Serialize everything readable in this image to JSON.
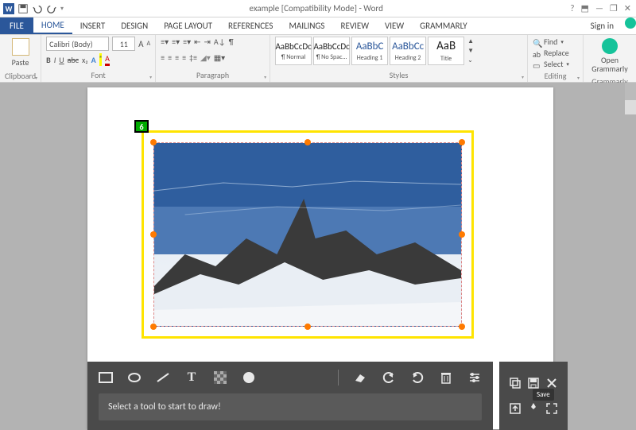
{
  "titlebar": {
    "title": "example [Compatibility Mode] - Word"
  },
  "window_controls": {
    "help": "?",
    "ribbon_toggle": "⬒",
    "minimize": "—",
    "restore": "❐",
    "close": "✕"
  },
  "ribbon_tabs": {
    "file": "FILE",
    "home": "HOME",
    "insert": "INSERT",
    "design": "DESIGN",
    "page_layout": "PAGE LAYOUT",
    "references": "REFERENCES",
    "mailings": "MAILINGS",
    "review": "REVIEW",
    "view": "VIEW",
    "grammarly": "GRAMMARLY",
    "signin": "Sign in"
  },
  "ribbon": {
    "clipboard": {
      "paste": "Paste",
      "label": "Clipboard"
    },
    "font": {
      "name": "Calibri (Body)",
      "size": "11",
      "label": "Font"
    },
    "paragraph": {
      "label": "Paragraph"
    },
    "styles": {
      "label": "Styles",
      "items": [
        {
          "sample": "AaBbCcDc",
          "name": "¶ Normal"
        },
        {
          "sample": "AaBbCcDc",
          "name": "¶ No Spac..."
        },
        {
          "sample": "AaBbC",
          "name": "Heading 1"
        },
        {
          "sample": "AaBbCc",
          "name": "Heading 2"
        },
        {
          "sample": "AaB",
          "name": "Title"
        }
      ]
    },
    "editing": {
      "find": "Find",
      "replace": "Replace",
      "select": "Select",
      "label": "Editing"
    },
    "grammarly_group": {
      "open": "Open Grammarly",
      "label": "Grammarly"
    }
  },
  "selection": {
    "badge": "6"
  },
  "screenshot_toolbar": {
    "message": "Select a tool to start to draw!",
    "icons": {
      "rect": "rectangle-icon",
      "ellipse": "ellipse-icon",
      "line": "line-icon",
      "text": "text-icon",
      "pixelate": "pixelate-icon",
      "counter": "counter-icon",
      "erase": "erase-icon",
      "undo": "undo-icon",
      "redo": "redo-icon",
      "delete": "delete-icon",
      "settings": "settings-icon"
    },
    "side_icons": {
      "copy": "copy-icon",
      "save": "save-icon",
      "close": "close-icon",
      "upload": "upload-icon",
      "pin": "pin-icon",
      "fullscreen": "fullscreen-icon"
    },
    "tooltip": "Save"
  }
}
